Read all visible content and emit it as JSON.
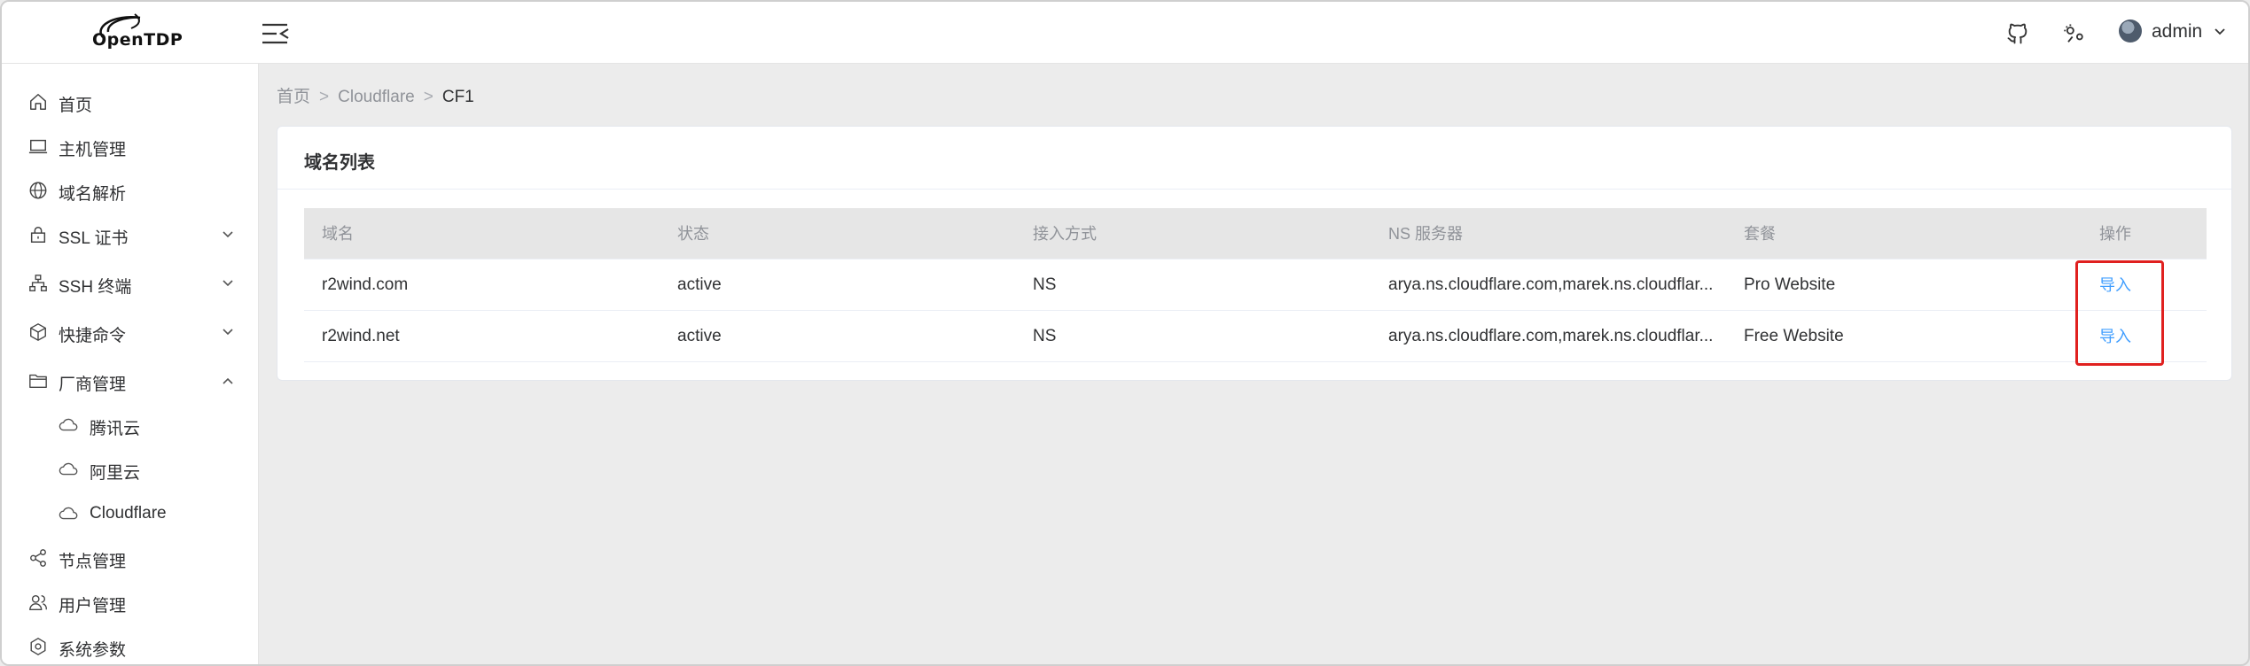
{
  "header": {
    "logo_text": "OpenTDP",
    "user_name": "admin",
    "icons": [
      "github-icon",
      "theme-icon",
      "avatar",
      "chevron-down-icon"
    ]
  },
  "sidebar": {
    "items": [
      {
        "label": "首页",
        "icon": "home-icon"
      },
      {
        "label": "主机管理",
        "icon": "laptop-icon"
      },
      {
        "label": "域名解析",
        "icon": "globe-icon"
      },
      {
        "label": "SSL 证书",
        "icon": "lock-icon",
        "arrow": "down"
      },
      {
        "label": "SSH 终端",
        "icon": "network-icon",
        "arrow": "down"
      },
      {
        "label": "快捷命令",
        "icon": "cube-icon",
        "arrow": "down"
      },
      {
        "label": "厂商管理",
        "icon": "folder-icon",
        "arrow": "up"
      },
      {
        "label": "节点管理",
        "icon": "share-icon"
      },
      {
        "label": "用户管理",
        "icon": "users-icon"
      },
      {
        "label": "系统参数",
        "icon": "settings-icon"
      }
    ],
    "sub_items": [
      {
        "label": "腾讯云",
        "icon": "cloud-icon"
      },
      {
        "label": "阿里云",
        "icon": "cloud-icon"
      },
      {
        "label": "Cloudflare",
        "icon": "cloud-icon"
      }
    ]
  },
  "breadcrumb": {
    "items": [
      "首页",
      "Cloudflare",
      "CF1"
    ],
    "separator": ">"
  },
  "card": {
    "title": "域名列表"
  },
  "table": {
    "columns": [
      "域名",
      "状态",
      "接入方式",
      "NS 服务器",
      "套餐",
      "操作"
    ],
    "rows": [
      {
        "domain": "r2wind.com",
        "status": "active",
        "access": "NS",
        "ns": "arya.ns.cloudflare.com,marek.ns.cloudflar...",
        "plan": "Pro Website",
        "action": "导入"
      },
      {
        "domain": "r2wind.net",
        "status": "active",
        "access": "NS",
        "ns": "arya.ns.cloudflare.com,marek.ns.cloudflar...",
        "plan": "Free Website",
        "action": "导入"
      }
    ]
  },
  "colors": {
    "link": "#409eff",
    "highlight": "#e0201f",
    "background": "#ececec"
  }
}
